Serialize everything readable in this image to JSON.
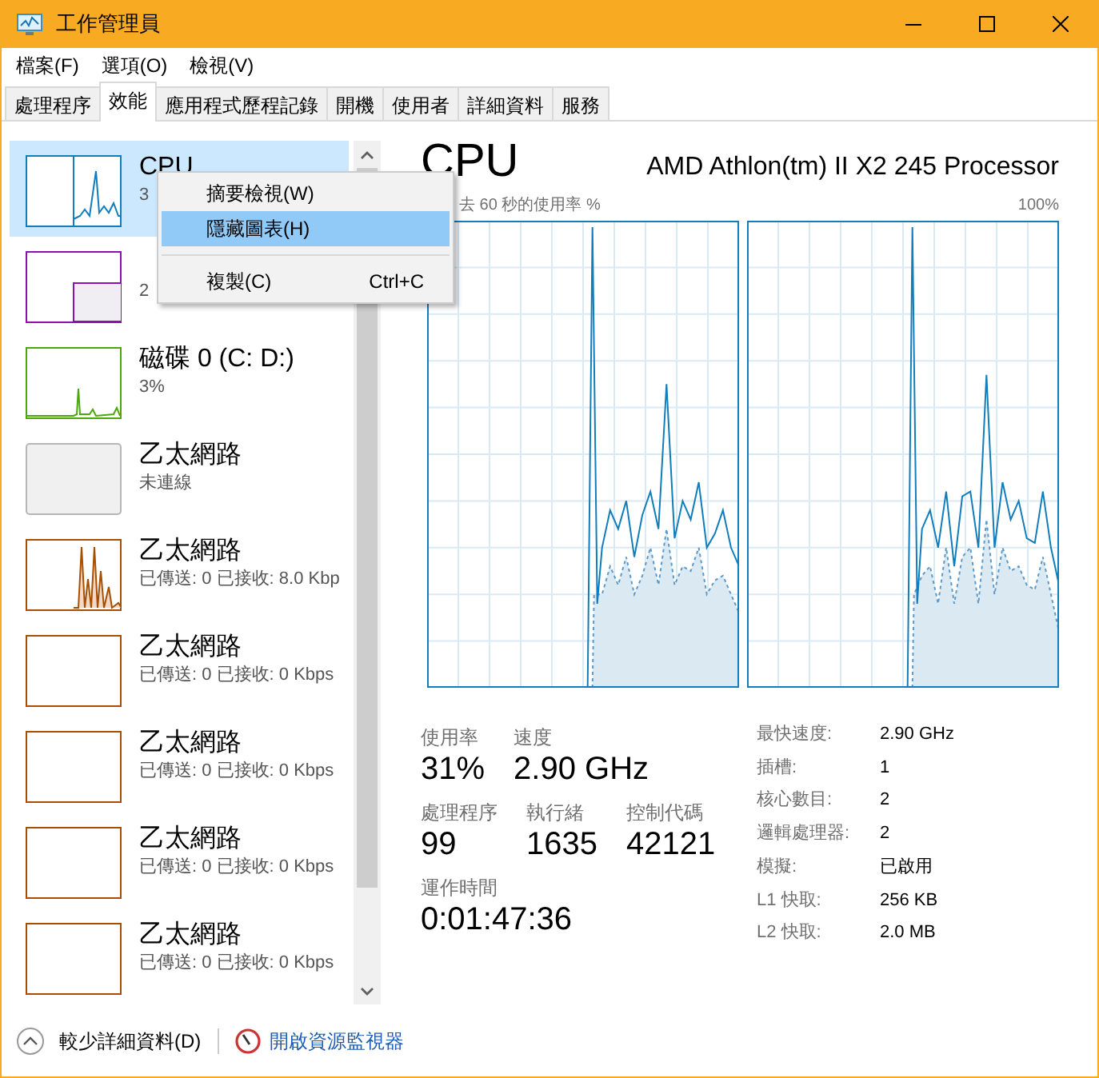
{
  "window": {
    "title": "工作管理員"
  },
  "menu": [
    "檔案(F)",
    "選項(O)",
    "檢視(V)"
  ],
  "tabs": [
    {
      "label": "處理程序",
      "selected": false
    },
    {
      "label": "效能",
      "selected": true
    },
    {
      "label": "應用程式歷程記錄",
      "selected": false
    },
    {
      "label": "開機",
      "selected": false
    },
    {
      "label": "使用者",
      "selected": false
    },
    {
      "label": "詳細資料",
      "selected": false
    },
    {
      "label": "服務",
      "selected": false
    }
  ],
  "sidebar": {
    "items": [
      {
        "kind": "cpu",
        "title": "CPU",
        "detail": "3",
        "selected": true,
        "color": "#117dbb"
      },
      {
        "kind": "memory",
        "detail": "2",
        "selected": false,
        "color": "#8b12ae"
      },
      {
        "kind": "disk",
        "title": "磁碟 0 (C: D:)",
        "detail": "3%",
        "selected": false,
        "color": "#4da60c"
      },
      {
        "kind": "disconnected",
        "title": "乙太網路",
        "detail": "未連線",
        "selected": false
      },
      {
        "kind": "network-active",
        "title": "乙太網路",
        "detail": "已傳送: 0 已接收: 8.0 Kbp",
        "selected": false,
        "color": "#a74f01"
      },
      {
        "kind": "network",
        "title": "乙太網路",
        "detail": "已傳送: 0 已接收: 0 Kbps",
        "selected": false,
        "color": "#a74f01"
      },
      {
        "kind": "network",
        "title": "乙太網路",
        "detail": "已傳送: 0 已接收: 0 Kbps",
        "selected": false,
        "color": "#a74f01"
      },
      {
        "kind": "network",
        "title": "乙太網路",
        "detail": "已傳送: 0 已接收: 0 Kbps",
        "selected": false,
        "color": "#a74f01"
      },
      {
        "kind": "network",
        "title": "乙太網路",
        "detail": "已傳送: 0 已接收: 0 Kbps",
        "selected": false,
        "color": "#a74f01"
      }
    ]
  },
  "context_menu": {
    "items": [
      {
        "kind": "item",
        "label": "摘要檢視(W)",
        "selected": false
      },
      {
        "kind": "item",
        "label": "隱藏圖表(H)",
        "selected": true
      },
      {
        "kind": "separator"
      },
      {
        "kind": "item",
        "label": "複製(C)",
        "shortcut": "Ctrl+C",
        "selected": false
      }
    ]
  },
  "main": {
    "title": "CPU",
    "processor": "AMD Athlon(tm) II X2 245 Processor",
    "graph_label": "去 60 秒的使用率 %",
    "graph_max": "100%",
    "stat_rows": [
      [
        {
          "label": "使用率",
          "value": "31%"
        },
        {
          "label": "速度",
          "value": "2.90 GHz"
        }
      ],
      [
        {
          "label": "處理程序",
          "value": "99"
        },
        {
          "label": "執行緒",
          "value": "1635"
        },
        {
          "label": "控制代碼",
          "value": "42121"
        }
      ],
      [
        {
          "label": "運作時間",
          "value": "0:01:47:36"
        }
      ]
    ],
    "details": [
      {
        "label": "最快速度:",
        "value": "2.90 GHz"
      },
      {
        "label": "插槽:",
        "value": "1"
      },
      {
        "label": "核心數目:",
        "value": "2"
      },
      {
        "label": "邏輯處理器:",
        "value": "2"
      },
      {
        "label": "模擬:",
        "value": "已啟用"
      },
      {
        "label": "L1 快取:",
        "value": "256 KB"
      },
      {
        "label": "L2 快取:",
        "value": "2.0 MB"
      }
    ]
  },
  "footer": {
    "toggle": "較少詳細資料(D)",
    "link": "開啟資源監視器"
  }
}
